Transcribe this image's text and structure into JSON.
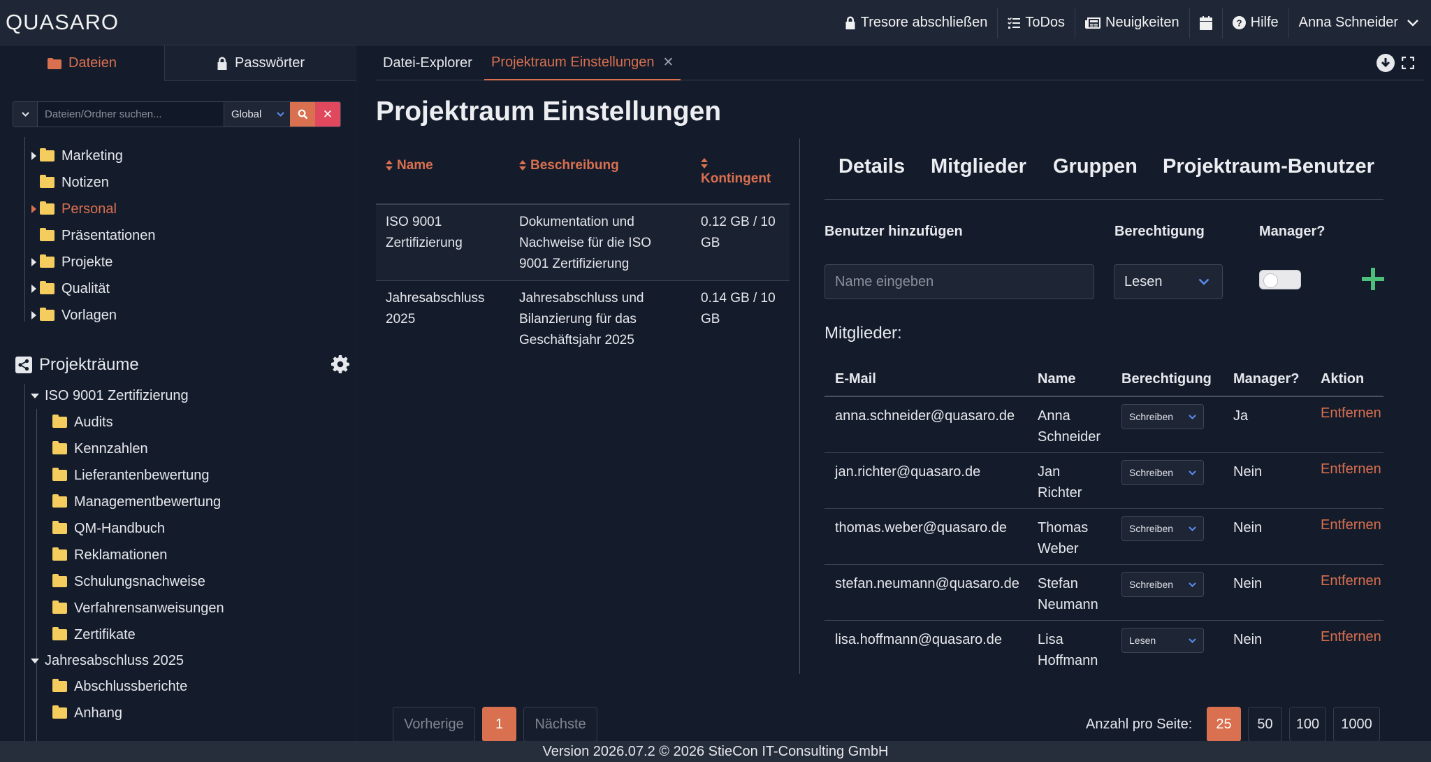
{
  "navbar": {
    "logo": "QUASARO",
    "lock_vaults": "Tresore abschließen",
    "todos": "ToDos",
    "news": "Neuigkeiten",
    "help": "Hilfe",
    "user": "Anna Schneider"
  },
  "sidebar": {
    "tabs": {
      "files": "Dateien",
      "passwords": "Passwörter"
    },
    "search": {
      "placeholder": "Dateien/Ordner suchen...",
      "scope": "Global"
    },
    "folders": [
      {
        "label": "Marketing",
        "expandable": true
      },
      {
        "label": "Notizen",
        "expandable": false
      },
      {
        "label": "Personal",
        "expandable": true,
        "active": true
      },
      {
        "label": "Präsentationen",
        "expandable": false
      },
      {
        "label": "Projekte",
        "expandable": true
      },
      {
        "label": "Qualität",
        "expandable": true
      },
      {
        "label": "Vorlagen",
        "expandable": true
      }
    ],
    "project_rooms_title": "Projekträume",
    "rooms": [
      {
        "label": "ISO 9001 Zertifizierung",
        "folders": [
          "Audits",
          "Kennzahlen",
          "Lieferantenbewertung",
          "Managementbewertung",
          "QM-Handbuch",
          "Reklamationen",
          "Schulungsnachweise",
          "Verfahrensanweisungen",
          "Zertifikate"
        ]
      },
      {
        "label": "Jahresabschluss 2025",
        "folders": [
          "Abschlussberichte",
          "Anhang"
        ]
      }
    ]
  },
  "content_tabs": {
    "explorer": "Datei-Explorer",
    "settings": "Projektraum Einstellungen"
  },
  "page_title": "Projektraum Einstellungen",
  "room_table": {
    "headers": {
      "name": "Name",
      "description": "Beschreibung",
      "quota": "Kontingent"
    },
    "rows": [
      {
        "name_l1": "ISO 9001",
        "name_l2": "Zertifizierung",
        "desc_l1": "Dokumentation und",
        "desc_l2": "Nachweise für die ISO",
        "desc_l3": "9001 Zertifizierung",
        "quota_l1": "0.12 GB / 10",
        "quota_l2": "GB"
      },
      {
        "name_l1": "Jahresabschluss",
        "name_l2": "2025",
        "desc_l1": "Jahresabschluss und",
        "desc_l2": "Bilanzierung für das",
        "desc_l3": "Geschäftsjahr 2025",
        "quota_l1": "0.14 GB / 10",
        "quota_l2": "GB"
      }
    ]
  },
  "settings_tabs": {
    "details": "Details",
    "members": "Mitglieder",
    "groups": "Gruppen",
    "room_users": "Projektraum-Benutzer"
  },
  "add_user": {
    "label_user": "Benutzer hinzufügen",
    "label_permission": "Berechtigung",
    "label_manager": "Manager?",
    "placeholder": "Name eingeben",
    "permission_value": "Lesen",
    "manager_on": false
  },
  "members_label": "Mitglieder:",
  "members_table": {
    "headers": {
      "email": "E-Mail",
      "name": "Name",
      "permission": "Berechtigung",
      "manager": "Manager?",
      "action": "Aktion"
    },
    "rows": [
      {
        "email": "anna.schneider@quasaro.de",
        "first": "Anna",
        "last": "Schneider",
        "permission": "Schreiben",
        "manager": "Ja",
        "action": "Entfernen"
      },
      {
        "email": "jan.richter@quasaro.de",
        "first": "Jan",
        "last": "Richter",
        "permission": "Schreiben",
        "manager": "Nein",
        "action": "Entfernen"
      },
      {
        "email": "thomas.weber@quasaro.de",
        "first": "Thomas",
        "last": "Weber",
        "permission": "Schreiben",
        "manager": "Nein",
        "action": "Entfernen"
      },
      {
        "email": "stefan.neumann@quasaro.de",
        "first": "Stefan",
        "last": "Neumann",
        "permission": "Schreiben",
        "manager": "Nein",
        "action": "Entfernen"
      },
      {
        "email": "lisa.hoffmann@quasaro.de",
        "first": "Lisa",
        "last": "Hoffmann",
        "permission": "Lesen",
        "manager": "Nein",
        "action": "Entfernen"
      }
    ]
  },
  "pagination": {
    "prev": "Vorherige",
    "current_page": "1",
    "next": "Nächste",
    "per_page_label": "Anzahl pro Seite:",
    "sizes": [
      "25",
      "50",
      "100",
      "1000"
    ],
    "active_size": "25"
  },
  "footer": "Version 2026.07.2 © 2026 StieCon IT-Consulting GmbH",
  "colors": {
    "accent": "#d9704f",
    "danger": "#e0485e",
    "add": "#4cc07a",
    "folder": "#f5cd5e",
    "background": "#141b2b"
  }
}
